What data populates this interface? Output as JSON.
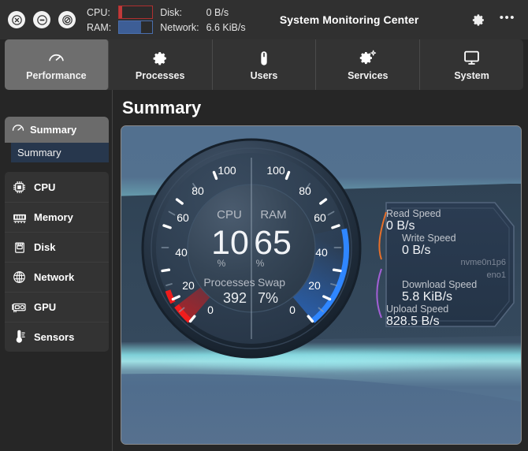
{
  "window": {
    "title": "System Monitoring Center",
    "controls": [
      {
        "name": "close",
        "glyph": "✕"
      },
      {
        "name": "minimize",
        "glyph": "—"
      },
      {
        "name": "maximize",
        "glyph": "⃠"
      }
    ],
    "actions": {
      "settings_icon": "gear-icon",
      "menu_icon": "more-options-icon",
      "menu_glyph": "•••"
    }
  },
  "header_metrics": {
    "cpu_label": "CPU:",
    "cpu_percent": 10,
    "ram_label": "RAM:",
    "ram_percent": 65,
    "disk_label": "Disk:",
    "disk_value": "0 B/s",
    "network_label": "Network:",
    "network_value": "6.6 KiB/s"
  },
  "tabs": [
    {
      "label": "Performance",
      "icon": "gauge-icon",
      "active": true
    },
    {
      "label": "Processes",
      "icon": "gear-icon",
      "active": false
    },
    {
      "label": "Users",
      "icon": "mouse-icon",
      "active": false
    },
    {
      "label": "Services",
      "icon": "gears-icon",
      "active": false
    },
    {
      "label": "System",
      "icon": "monitor-icon",
      "active": false
    }
  ],
  "sidebar": {
    "header": {
      "label": "Summary",
      "icon": "gauge-icon"
    },
    "list": [
      {
        "label": "Summary",
        "selected": true
      }
    ],
    "nav": [
      {
        "label": "CPU",
        "icon": "cpu-chip-icon"
      },
      {
        "label": "Memory",
        "icon": "memory-stick-icon"
      },
      {
        "label": "Disk",
        "icon": "hard-disk-icon"
      },
      {
        "label": "Network",
        "icon": "globe-icon"
      },
      {
        "label": "GPU",
        "icon": "gpu-card-icon"
      },
      {
        "label": "Sensors",
        "icon": "thermometer-icon"
      }
    ]
  },
  "main": {
    "page_title": "Summary"
  },
  "gauge": {
    "left": {
      "name": "CPU",
      "value": "10",
      "unit": "%",
      "sub_label": "Processes",
      "sub_value": "392",
      "arc_color": "#e01b1b",
      "percent": 10
    },
    "right": {
      "name": "RAM",
      "value": "65",
      "unit": "%",
      "sub_label": "Swap",
      "sub_value": "7%",
      "arc_color": "#1e6ef0",
      "percent": 65
    },
    "ticks": [
      "0",
      "20",
      "40",
      "60",
      "80",
      "100"
    ]
  },
  "stats": [
    {
      "label": "Read Speed",
      "value": "0 B/s",
      "accent": "#e8702a",
      "indent": 0
    },
    {
      "label": "Write Speed",
      "value": "0 B/s",
      "accent": "#e8702a",
      "indent": 1
    },
    {
      "label": "Download Speed",
      "value": "5.8 KiB/s",
      "accent": "#a35fd6",
      "indent": 1
    },
    {
      "label": "Upload Speed",
      "value": "828.5 B/s",
      "accent": "#a35fd6",
      "indent": 0
    }
  ],
  "devices": {
    "disk": "nvme0n1p6",
    "network": "eno1"
  },
  "chart_data": {
    "type": "gauge",
    "title": "Summary",
    "gauges": [
      {
        "name": "CPU",
        "value": 10,
        "unit": "%",
        "min": 0,
        "max": 100,
        "ticks": [
          0,
          20,
          40,
          60,
          80,
          100
        ],
        "color": "#e01b1b"
      },
      {
        "name": "RAM",
        "value": 65,
        "unit": "%",
        "min": 0,
        "max": 100,
        "ticks": [
          0,
          20,
          40,
          60,
          80,
          100
        ],
        "color": "#1e6ef0"
      }
    ],
    "readouts": [
      {
        "name": "Processes",
        "value": 392
      },
      {
        "name": "Swap",
        "value": "7%"
      },
      {
        "name": "Read Speed",
        "value": "0 B/s"
      },
      {
        "name": "Write Speed",
        "value": "0 B/s"
      },
      {
        "name": "Download Speed",
        "value": "5.8 KiB/s"
      },
      {
        "name": "Upload Speed",
        "value": "828.5 B/s"
      }
    ]
  }
}
